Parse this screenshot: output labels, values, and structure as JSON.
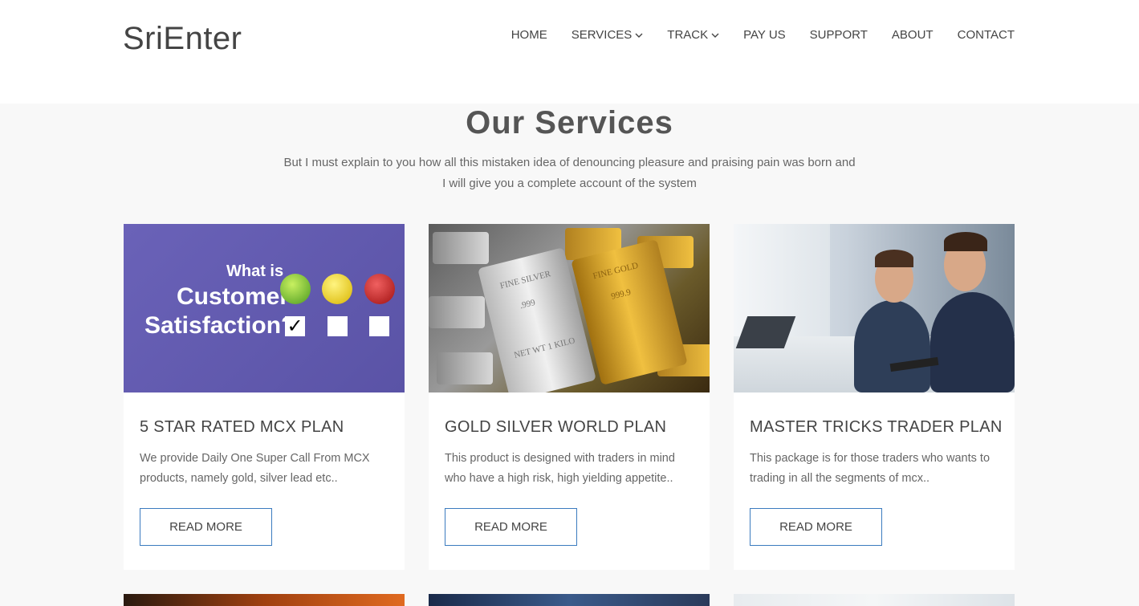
{
  "header": {
    "logo": "SriEnter",
    "nav": [
      {
        "label": "HOME",
        "has_dropdown": false
      },
      {
        "label": "SERVICES",
        "has_dropdown": true
      },
      {
        "label": "TRACK",
        "has_dropdown": true
      },
      {
        "label": "PAY US",
        "has_dropdown": false
      },
      {
        "label": "SUPPORT",
        "has_dropdown": false
      },
      {
        "label": "ABOUT",
        "has_dropdown": false
      },
      {
        "label": "CONTACT",
        "has_dropdown": false
      }
    ]
  },
  "services": {
    "title": "Our Services",
    "subtitle_line1": "But I must explain to you how all this mistaken idea of denouncing pleasure and praising pain was born and",
    "subtitle_line2": "I will give you a complete account of the system",
    "cards": [
      {
        "title": "5 STAR RATED MCX PLAN",
        "text": "We provide Daily One Super Call From MCX products, namely gold, silver lead etc..",
        "button": "READ MORE",
        "image": {
          "what_is": "What is",
          "line1": "Customer",
          "line2": "Satisfaction?",
          "check": "✓"
        }
      },
      {
        "title": "GOLD SILVER WORLD PLAN",
        "text": "This product is designed with traders in mind who have a high risk, high yielding appetite..",
        "button": "READ MORE",
        "image": {
          "silver_label": "FINE SILVER",
          "silver_purity": ".999",
          "silver_weight": "NET WT 1 KILO",
          "gold_label": "FINE GOLD",
          "gold_purity": "999.9"
        }
      },
      {
        "title": "MASTER TRICKS TRADER PLAN",
        "text": "This package is for those traders who wants to trading in all the segments of mcx..",
        "button": "READ MORE"
      }
    ]
  },
  "colors": {
    "accent": "#3b7bbf",
    "background": "#f8f8f8",
    "card_bg": "#ffffff",
    "text": "#444444"
  }
}
